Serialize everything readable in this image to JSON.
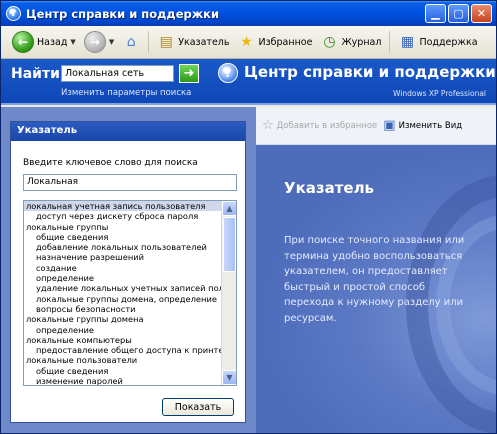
{
  "window": {
    "title": "Центр справки и поддержки"
  },
  "toolbar": {
    "back_label": "Назад",
    "index_label": "Указатель",
    "favorites_label": "Избранное",
    "history_label": "Журнал",
    "support_label": "Поддержка"
  },
  "header": {
    "find_label": "Найти",
    "search_value": "Локальная сеть",
    "search_options_link": "Изменить параметры поиска",
    "brand_title": "Центр справки и поддержки",
    "os_name": "Windows XP Professional"
  },
  "index_panel": {
    "title": "Указатель",
    "keyword_label": "Введите ключевое слово для поиска",
    "keyword_value": "Локальная",
    "items": [
      {
        "text": "локальная учетная запись пользователя",
        "level": 0,
        "selected": true
      },
      {
        "text": "доступ через дискету сброса пароля",
        "level": 1
      },
      {
        "text": "локальные группы",
        "level": 0
      },
      {
        "text": "общие сведения",
        "level": 1
      },
      {
        "text": "добавление локальных пользователей",
        "level": 1
      },
      {
        "text": "назначение разрешений",
        "level": 1
      },
      {
        "text": "создание",
        "level": 1
      },
      {
        "text": "определение",
        "level": 1
      },
      {
        "text": "удаление локальных учетных записей польз",
        "level": 1
      },
      {
        "text": "локальные группы домена, определение",
        "level": 1
      },
      {
        "text": "вопросы безопасности",
        "level": 1
      },
      {
        "text": "локальные группы домена",
        "level": 0
      },
      {
        "text": "определение",
        "level": 1
      },
      {
        "text": "локальные компьютеры",
        "level": 0
      },
      {
        "text": "предоставление общего доступа к принтер",
        "level": 1
      },
      {
        "text": "локальные пользователи",
        "level": 0
      },
      {
        "text": "общие сведения",
        "level": 1
      },
      {
        "text": "изменение паролей",
        "level": 1
      }
    ],
    "show_button": "Показать"
  },
  "right_toolbar": {
    "add_favorites": "Добавить в избранное",
    "change_view": "Изменить Вид"
  },
  "content": {
    "heading": "Указатель",
    "description": "При поиске точного названия или термина удобно воспользоваться указателем, он предоставляет быстрый и простой способ перехода к нужному разделу или ресурсам."
  }
}
